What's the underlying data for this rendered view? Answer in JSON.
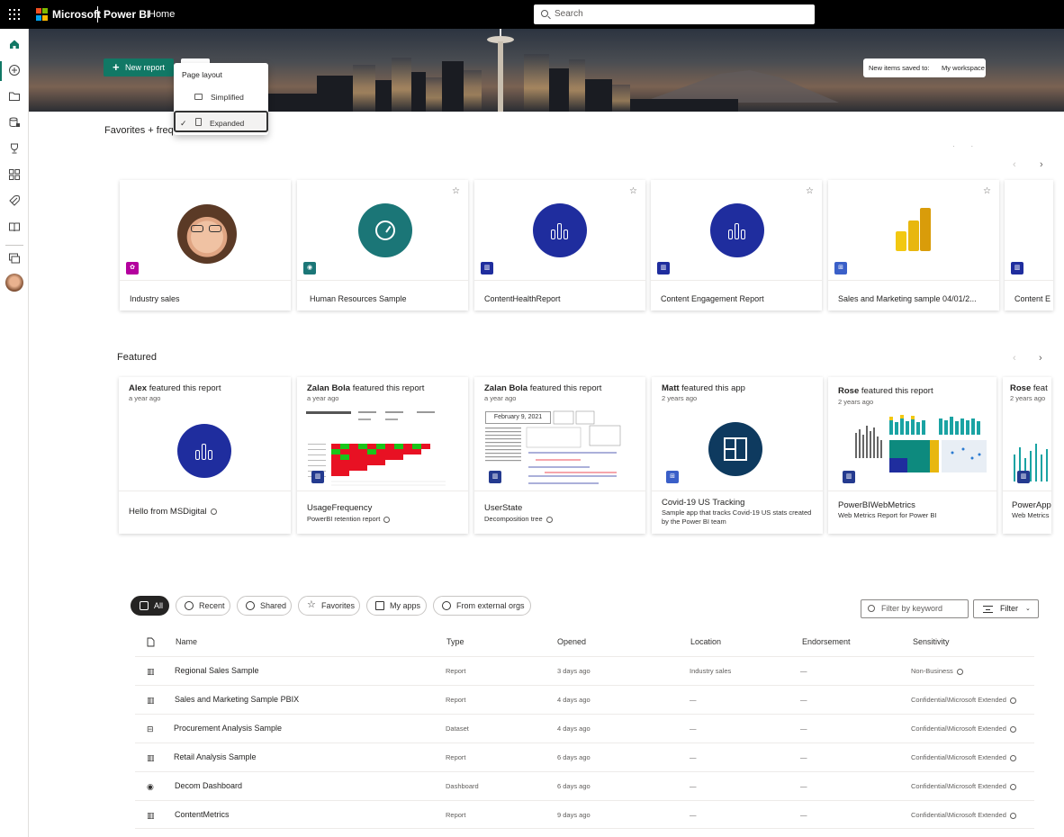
{
  "topbar": {
    "brand": "Microsoft",
    "product": "Power BI",
    "page": "Home",
    "search_placeholder": "Search"
  },
  "colors": {
    "accent": "#117865",
    "report_blue": "#1f2d9e",
    "topbar": "#000000"
  },
  "nav": [
    "home-icon",
    "create-icon",
    "browse-icon",
    "onelake-icon",
    "goals-icon",
    "apps-icon",
    "deployment-icon",
    "learn-icon",
    "workspaces-icon",
    "account-icon"
  ],
  "hero": {
    "new_report": "New report",
    "saved_label": "New items saved to:",
    "saved_value": "My workspace"
  },
  "layout_menu": {
    "title": "Page layout",
    "items": [
      "Simplified",
      "Expanded"
    ],
    "selected": "Expanded"
  },
  "favorites": {
    "title": "Favorites + frequents",
    "cards": [
      {
        "name": "Industry sales",
        "type": "app"
      },
      {
        "name": "Human Resources Sample",
        "type": "dashboard"
      },
      {
        "name": "ContentHealthReport",
        "type": "report"
      },
      {
        "name": "Content Engagement Report",
        "type": "report"
      },
      {
        "name": "Sales and Marketing sample 04/01/2...",
        "type": "dataset"
      },
      {
        "name": "Content E",
        "type": "report"
      }
    ]
  },
  "featured": {
    "title": "Featured",
    "cards": [
      {
        "who": "Alex",
        "action": "featured this report",
        "when": "a year ago",
        "title": "Hello from MSDigital",
        "sub": ""
      },
      {
        "who": "Zalan Bola",
        "action": "featured this report",
        "when": "a year ago",
        "title": "UsageFrequency",
        "sub": "PowerBI retention report"
      },
      {
        "who": "Zalan Bola",
        "action": "featured this report",
        "when": "a year ago",
        "title": "UserState",
        "sub": "Decomposition tree",
        "thumb_date": "February 9, 2021"
      },
      {
        "who": "Matt",
        "action": "featured this app",
        "when": "2 years ago",
        "title": "Covid-19 US Tracking",
        "sub": "Sample app that tracks Covid-19 US stats created by the Power BI team"
      },
      {
        "who": "Rose",
        "action": "featured this report",
        "when": "2 years ago",
        "title": "PowerBIWebMetrics",
        "sub": "Web Metrics Report for Power BI"
      },
      {
        "who": "Rose",
        "action": "feat",
        "when": "2 years ago",
        "title": "PowerApp",
        "sub": "Web Metrics"
      }
    ]
  },
  "pills": [
    "All",
    "Recent",
    "Shared",
    "Favorites",
    "My apps",
    "From external orgs"
  ],
  "filter": {
    "placeholder": "Filter by keyword",
    "button": "Filter"
  },
  "table": {
    "headers": {
      "name": "Name",
      "type": "Type",
      "opened": "Opened",
      "location": "Location",
      "endorsement": "Endorsement",
      "sensitivity": "Sensitivity"
    },
    "rows": [
      {
        "icon": "report-icon",
        "name": "Regional Sales Sample",
        "type": "Report",
        "opened": "3 days ago",
        "location": "Industry sales",
        "endorsement": "—",
        "sensitivity": "Non-Business"
      },
      {
        "icon": "report-icon",
        "name": "Sales and Marketing Sample PBIX",
        "type": "Report",
        "opened": "4 days ago",
        "location": "—",
        "endorsement": "—",
        "sensitivity": "Confidential\\Microsoft Extended"
      },
      {
        "icon": "dataset-icon",
        "name": "Procurement Analysis Sample",
        "type": "Dataset",
        "opened": "4 days ago",
        "location": "—",
        "endorsement": "—",
        "sensitivity": "Confidential\\Microsoft Extended"
      },
      {
        "icon": "report-icon",
        "name": "Retail Analysis Sample",
        "type": "Report",
        "opened": "6 days ago",
        "location": "—",
        "endorsement": "—",
        "sensitivity": "Confidential\\Microsoft Extended"
      },
      {
        "icon": "dashboard-icon",
        "name": "Decom Dashboard",
        "type": "Dashboard",
        "opened": "6 days ago",
        "location": "—",
        "endorsement": "—",
        "sensitivity": "Confidential\\Microsoft Extended"
      },
      {
        "icon": "report-icon",
        "name": "ContentMetrics",
        "type": "Report",
        "opened": "9 days ago",
        "location": "—",
        "endorsement": "—",
        "sensitivity": "Confidential\\Microsoft Extended"
      }
    ]
  }
}
